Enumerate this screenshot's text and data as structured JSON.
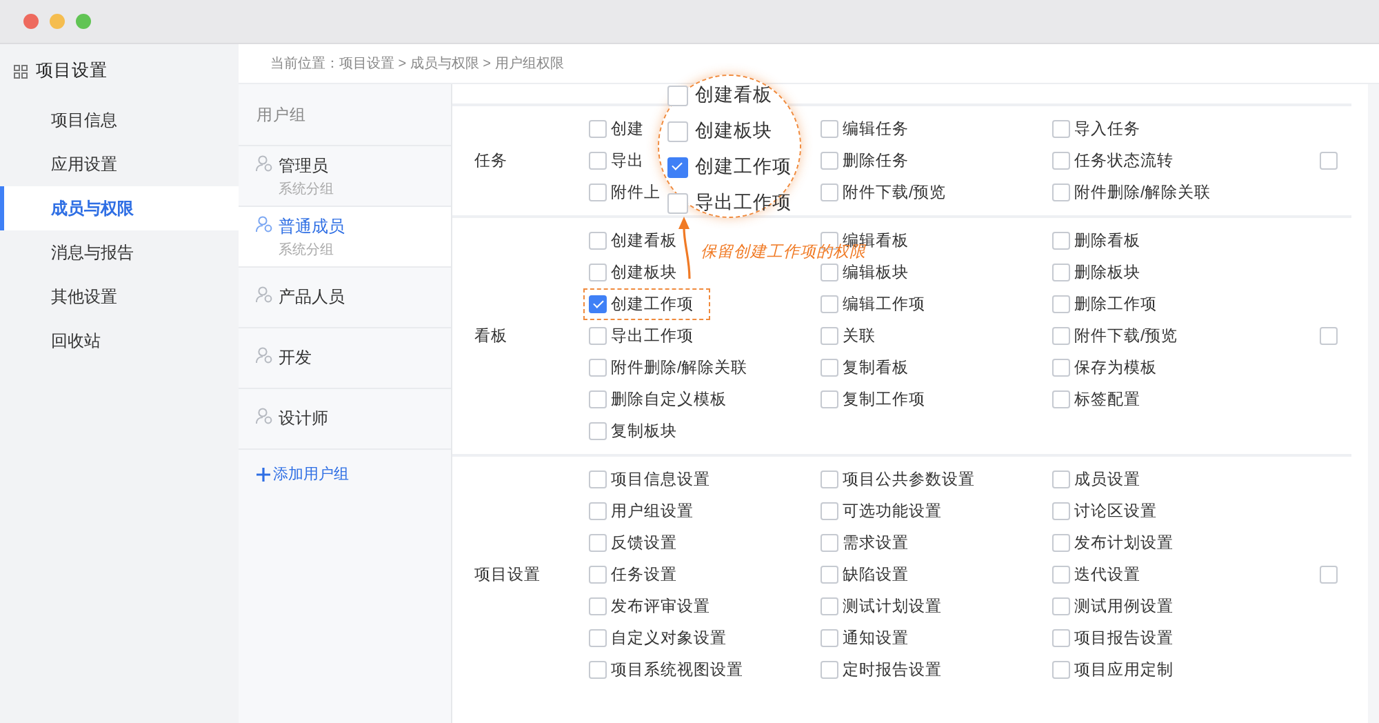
{
  "window": {
    "traffic_lights": [
      {
        "color": "#ee6a5e"
      },
      {
        "color": "#f5bd4f"
      },
      {
        "color": "#61c454"
      }
    ]
  },
  "sidebar": {
    "title": "项目设置",
    "items": [
      {
        "label": "项目信息",
        "selected": false
      },
      {
        "label": "应用设置",
        "selected": false
      },
      {
        "label": "成员与权限",
        "selected": true
      },
      {
        "label": "消息与报告",
        "selected": false
      },
      {
        "label": "其他设置",
        "selected": false
      },
      {
        "label": "回收站",
        "selected": false
      }
    ]
  },
  "breadcrumb": "当前位置：项目设置 > 成员与权限 > 用户组权限",
  "groups": {
    "title": "用户组",
    "items": [
      {
        "name": "管理员",
        "subtitle": "系统分组",
        "selected": false
      },
      {
        "name": "普通成员",
        "subtitle": "系统分组",
        "selected": true
      },
      {
        "name": "产品人员",
        "selected": false
      },
      {
        "name": "开发",
        "selected": false
      },
      {
        "name": "设计师",
        "selected": false
      }
    ],
    "add_label": "添加用户组"
  },
  "permissions": [
    {
      "section": "任务",
      "select_all": false,
      "items": [
        {
          "label": "创建",
          "checked": false,
          "highlighted": false
        },
        {
          "label": "编辑任务",
          "checked": false,
          "highlighted": false
        },
        {
          "label": "导入任务",
          "checked": false,
          "highlighted": false
        },
        {
          "label": "导出",
          "checked": false,
          "highlighted": false
        },
        {
          "label": "删除任务",
          "checked": false,
          "highlighted": false
        },
        {
          "label": "任务状态流转",
          "checked": false,
          "highlighted": false
        },
        {
          "label": "附件上",
          "checked": false,
          "highlighted": false
        },
        {
          "label": "附件下载/预览",
          "checked": false,
          "highlighted": false
        },
        {
          "label": "附件删除/解除关联",
          "checked": false,
          "highlighted": false
        }
      ]
    },
    {
      "section": "看板",
      "select_all": false,
      "items": [
        {
          "label": "创建看板",
          "checked": false,
          "highlighted": false
        },
        {
          "label": "编辑看板",
          "checked": false,
          "highlighted": false
        },
        {
          "label": "删除看板",
          "checked": false,
          "highlighted": false
        },
        {
          "label": "创建板块",
          "checked": false,
          "highlighted": false
        },
        {
          "label": "编辑板块",
          "checked": false,
          "highlighted": false
        },
        {
          "label": "删除板块",
          "checked": false,
          "highlighted": false
        },
        {
          "label": "创建工作项",
          "checked": true,
          "highlighted": true
        },
        {
          "label": "编辑工作项",
          "checked": false,
          "highlighted": false
        },
        {
          "label": "删除工作项",
          "checked": false,
          "highlighted": false
        },
        {
          "label": "导出工作项",
          "checked": false,
          "highlighted": false
        },
        {
          "label": "关联",
          "checked": false,
          "highlighted": false
        },
        {
          "label": "附件下载/预览",
          "checked": false,
          "highlighted": false
        },
        {
          "label": "附件删除/解除关联",
          "checked": false,
          "highlighted": false
        },
        {
          "label": "复制看板",
          "checked": false,
          "highlighted": false
        },
        {
          "label": "保存为模板",
          "checked": false,
          "highlighted": false
        },
        {
          "label": "删除自定义模板",
          "checked": false,
          "highlighted": false
        },
        {
          "label": "复制工作项",
          "checked": false,
          "highlighted": false
        },
        {
          "label": "标签配置",
          "checked": false,
          "highlighted": false
        },
        {
          "label": "复制板块",
          "checked": false,
          "highlighted": false
        }
      ]
    },
    {
      "section": "项目设置",
      "select_all": false,
      "items": [
        {
          "label": "项目信息设置",
          "checked": false,
          "highlighted": false
        },
        {
          "label": "项目公共参数设置",
          "checked": false,
          "highlighted": false
        },
        {
          "label": "成员设置",
          "checked": false,
          "highlighted": false
        },
        {
          "label": "用户组设置",
          "checked": false,
          "highlighted": false
        },
        {
          "label": "可选功能设置",
          "checked": false,
          "highlighted": false
        },
        {
          "label": "讨论区设置",
          "checked": false,
          "highlighted": false
        },
        {
          "label": "反馈设置",
          "checked": false,
          "highlighted": false
        },
        {
          "label": "需求设置",
          "checked": false,
          "highlighted": false
        },
        {
          "label": "发布计划设置",
          "checked": false,
          "highlighted": false
        },
        {
          "label": "任务设置",
          "checked": false,
          "highlighted": false
        },
        {
          "label": "缺陷设置",
          "checked": false,
          "highlighted": false
        },
        {
          "label": "迭代设置",
          "checked": false,
          "highlighted": false
        },
        {
          "label": "发布评审设置",
          "checked": false,
          "highlighted": false
        },
        {
          "label": "测试计划设置",
          "checked": false,
          "highlighted": false
        },
        {
          "label": "测试用例设置",
          "checked": false,
          "highlighted": false
        },
        {
          "label": "自定义对象设置",
          "checked": false,
          "highlighted": false
        },
        {
          "label": "通知设置",
          "checked": false,
          "highlighted": false
        },
        {
          "label": "项目报告设置",
          "checked": false,
          "highlighted": false
        },
        {
          "label": "项目系统视图设置",
          "checked": false,
          "highlighted": false
        },
        {
          "label": "定时报告设置",
          "checked": false,
          "highlighted": false
        },
        {
          "label": "项目应用定制",
          "checked": false,
          "highlighted": false
        }
      ]
    }
  ],
  "magnifier": {
    "items": [
      {
        "label": "创建看板",
        "checked": false
      },
      {
        "label": "创建板块",
        "checked": false
      },
      {
        "label": "创建工作项",
        "checked": true
      },
      {
        "label": "导出工作项",
        "checked": false
      }
    ]
  },
  "annotation": {
    "text": "保留创建工作项的权限"
  }
}
